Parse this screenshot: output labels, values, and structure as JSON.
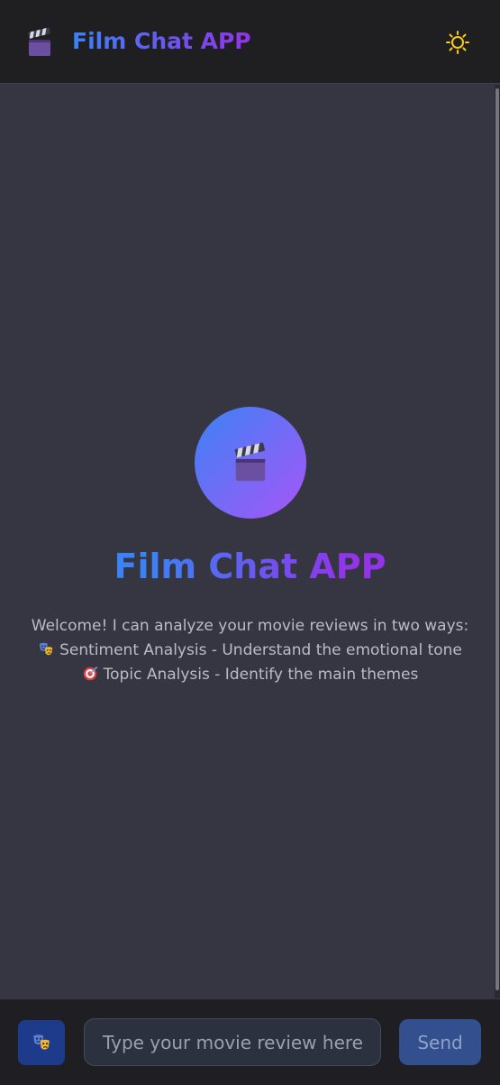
{
  "header": {
    "title": "Film Chat APP",
    "logo_icon": "clapperboard-icon",
    "theme_icon": "sun-icon"
  },
  "welcome": {
    "title": "Film Chat APP",
    "avatar_icon": "clapperboard-icon",
    "intro": "Welcome! I can analyze your movie reviews in two ways:",
    "features": [
      {
        "icon": "theater-masks-icon",
        "text": "Sentiment Analysis - Understand the emotional tone"
      },
      {
        "icon": "bullseye-icon",
        "text": "Topic Analysis - Identify the main themes"
      }
    ]
  },
  "footer": {
    "mode_icon": "theater-masks-icon",
    "input_placeholder": "Type your movie review here...",
    "send_label": "Send"
  },
  "colors": {
    "gradient_start": "#3b82f6",
    "gradient_end": "#9333ea",
    "background": "#363643",
    "header_background": "#1f1f22",
    "accent_button": "#334f8d"
  }
}
